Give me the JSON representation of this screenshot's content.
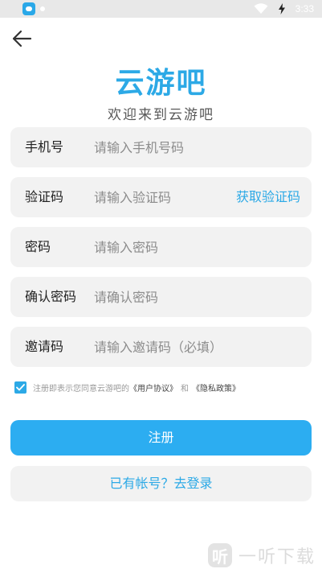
{
  "status_bar": {
    "time": "3:33",
    "icons": [
      "app-icon",
      "wifi-icon",
      "charging-icon"
    ]
  },
  "header": {
    "back_icon": "arrow-left-icon"
  },
  "logo": {
    "title": "云游吧",
    "subtitle": "欢迎来到云游吧",
    "color": "#2ca9e6"
  },
  "form": {
    "phone": {
      "label": "手机号",
      "placeholder": "请输入手机号码",
      "value": ""
    },
    "code": {
      "label": "验证码",
      "placeholder": "请输入验证码",
      "value": "",
      "action": "获取验证码"
    },
    "password": {
      "label": "密码",
      "placeholder": "请输入密码",
      "value": ""
    },
    "confirm": {
      "label": "确认密码",
      "placeholder": "请确认密码",
      "value": ""
    },
    "invite": {
      "label": "邀请码",
      "placeholder": "请输入邀请码（必填）",
      "value": ""
    }
  },
  "agreement": {
    "checked": true,
    "prefix": "注册即表示您同意云游吧的",
    "user_agreement": "《用户协议》",
    "and": "和",
    "privacy_policy": "《隐私政策》"
  },
  "buttons": {
    "register": "注册",
    "login": "已有帐号？去登录"
  },
  "colors": {
    "accent": "#2ca9e6",
    "primary_button": "#2cadf1",
    "field_bg": "#f2f2f2"
  },
  "watermark": {
    "logo_glyph": "听",
    "text": "一听下载"
  }
}
